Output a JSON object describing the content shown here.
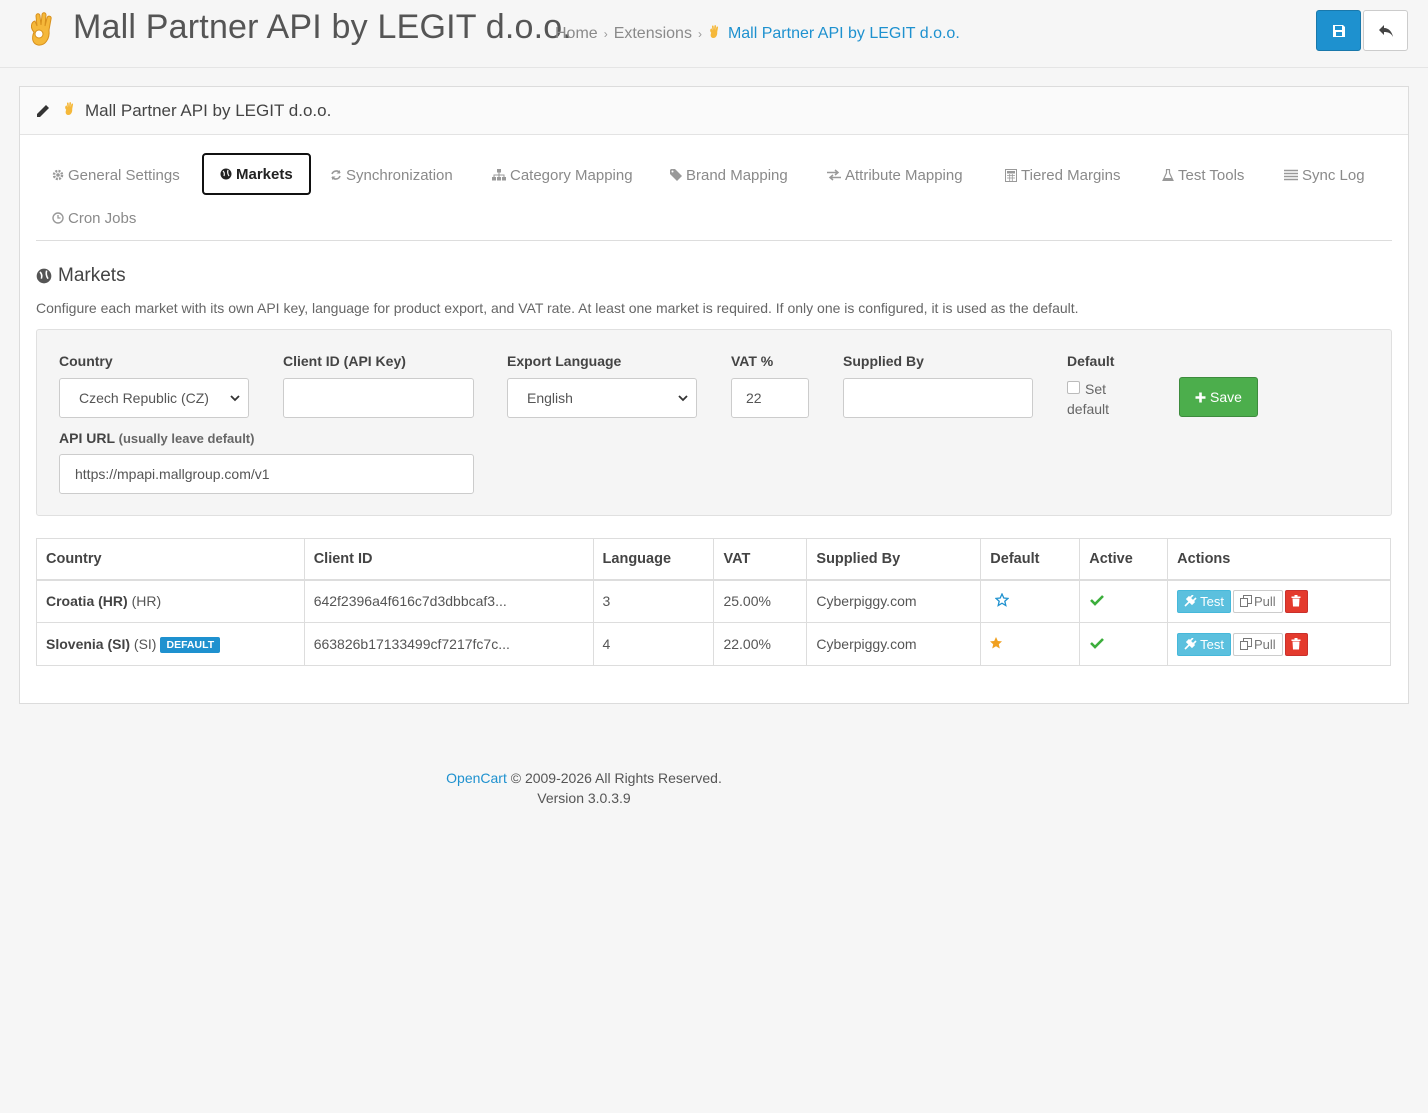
{
  "header": {
    "title": "Mall Partner API by LEGIT d.o.o.",
    "breadcrumb": [
      "Home",
      "Extensions",
      "Mall Partner API by LEGIT d.o.o."
    ],
    "save_icon": "floppy-disk-icon",
    "back_icon": "reply-arrow-icon"
  },
  "panel": {
    "title": "Mall Partner API by LEGIT d.o.o."
  },
  "tabs": [
    {
      "label": "General Settings",
      "icon": "gear-icon"
    },
    {
      "label": "Markets",
      "icon": "globe-icon"
    },
    {
      "label": "Synchronization",
      "icon": "refresh-icon"
    },
    {
      "label": "Category Mapping",
      "icon": "sitemap-icon"
    },
    {
      "label": "Brand Mapping",
      "icon": "tag-icon"
    },
    {
      "label": "Attribute Mapping",
      "icon": "exchange-icon"
    },
    {
      "label": "Tiered Margins",
      "icon": "calculator-icon"
    },
    {
      "label": "Test Tools",
      "icon": "flask-icon"
    },
    {
      "label": "Sync Log",
      "icon": "list-icon"
    },
    {
      "label": "Cron Jobs",
      "icon": "clock-icon"
    }
  ],
  "markets": {
    "title": "Markets",
    "description": "Configure each market with its own API key, language for product export, and VAT rate. At least one market is required. If only one is configured, it is used as the default.",
    "form": {
      "country_label": "Country",
      "country_value": "Czech Republic (CZ)",
      "client_id_label": "Client ID (API Key)",
      "client_id_value": "",
      "export_language_label": "Export Language",
      "export_language_value": "English",
      "vat_label": "VAT %",
      "vat_value": "22",
      "supplied_by_label": "Supplied By",
      "supplied_by_value": "",
      "default_label": "Default",
      "set_default_label": "Set default",
      "save_label": "Save",
      "api_url_label": "API URL",
      "api_url_hint": "(usually leave default)",
      "api_url_value": "https://mpapi.mallgroup.com/v1"
    },
    "table": {
      "headers": [
        "Country",
        "Client ID",
        "Language",
        "VAT",
        "Supplied By",
        "Default",
        "Active",
        "Actions"
      ],
      "rows": [
        {
          "country": "Croatia (HR)",
          "code": "(HR)",
          "badge": "",
          "client_id": "642f2396a4f616c7d3dbbcaf3...",
          "language": "3",
          "vat": "25.00%",
          "supplied_by": "Cyberpiggy.com",
          "default": false,
          "active": true
        },
        {
          "country": "Slovenia (SI)",
          "code": "(SI)",
          "badge": "DEFAULT",
          "client_id": "663826b17133499cf7217fc7c...",
          "language": "4",
          "vat": "22.00%",
          "supplied_by": "Cyberpiggy.com",
          "default": true,
          "active": true
        }
      ],
      "actions": {
        "test": "Test",
        "pull": "Pull"
      }
    }
  },
  "footer": {
    "link": "OpenCart",
    "copyright": "© 2009-2026 All Rights Reserved.",
    "version": "Version 3.0.3.9"
  },
  "colors": {
    "primary": "#1e91cf",
    "success": "#4cae4c",
    "info": "#5bc0de",
    "danger": "#e43a2d",
    "star": "#f0a020",
    "check": "#3cae3c"
  }
}
